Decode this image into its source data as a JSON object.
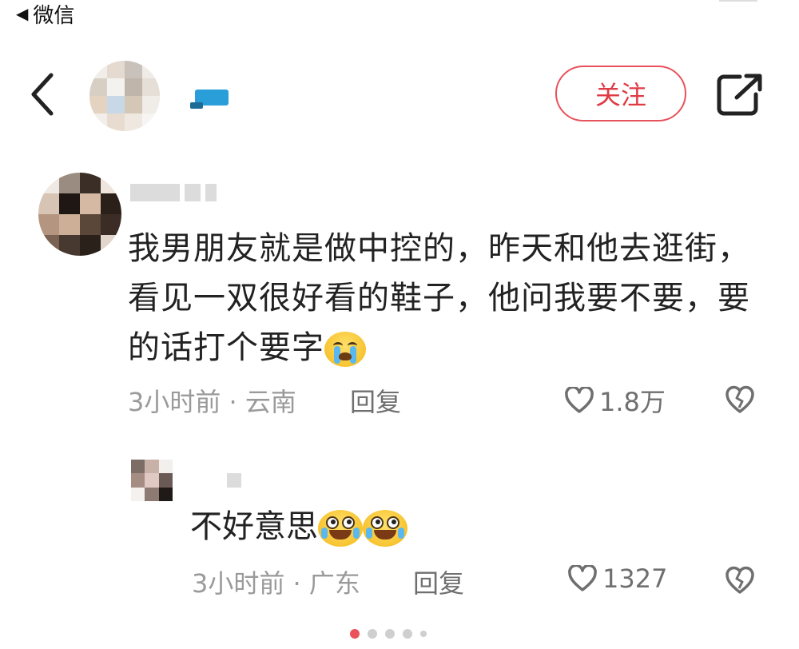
{
  "status_bar": {
    "back_label": "微信"
  },
  "header": {
    "follow_label": "关注",
    "back_icon": "chevron-left-icon",
    "share_icon": "share-icon"
  },
  "comment": {
    "text": "我男朋友就是做中控的，昨天和他去逛街，看见一双很好看的鞋子，他问我要不要，要的话打个要字",
    "emoji": "crying-face-emoji",
    "time_location": "3小时前 · 云南",
    "reply_label": "回复",
    "like_count": "1.8万"
  },
  "reply": {
    "text": "不好意思",
    "emojis": [
      "embarrassed-face-emoji",
      "embarrassed-face-emoji"
    ],
    "time_location": "3小时前 · 广东",
    "reply_label": "回复",
    "like_count": "1327"
  },
  "pagination": {
    "total": 5,
    "active": 1
  },
  "colors": {
    "accent": "#e9525b",
    "meta": "#9a9a9a",
    "text": "#222222"
  }
}
